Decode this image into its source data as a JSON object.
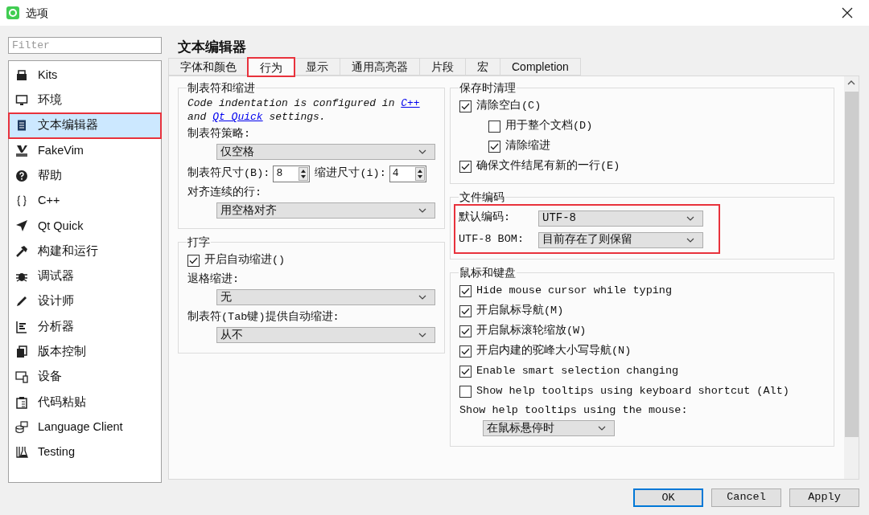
{
  "window": {
    "title": "选项"
  },
  "filter": {
    "placeholder": "Filter"
  },
  "sidebar": {
    "items": [
      {
        "label": "Kits",
        "selected": false,
        "highlighted": false
      },
      {
        "label": "环境",
        "selected": false,
        "highlighted": false
      },
      {
        "label": "文本编辑器",
        "selected": true,
        "highlighted": true
      },
      {
        "label": "FakeVim",
        "selected": false,
        "highlighted": false
      },
      {
        "label": "帮助",
        "selected": false,
        "highlighted": false
      },
      {
        "label": "C++",
        "selected": false,
        "highlighted": false
      },
      {
        "label": "Qt Quick",
        "selected": false,
        "highlighted": false
      },
      {
        "label": "构建和运行",
        "selected": false,
        "highlighted": false
      },
      {
        "label": "调试器",
        "selected": false,
        "highlighted": false
      },
      {
        "label": "设计师",
        "selected": false,
        "highlighted": false
      },
      {
        "label": "分析器",
        "selected": false,
        "highlighted": false
      },
      {
        "label": "版本控制",
        "selected": false,
        "highlighted": false
      },
      {
        "label": "设备",
        "selected": false,
        "highlighted": false
      },
      {
        "label": "代码粘贴",
        "selected": false,
        "highlighted": false
      },
      {
        "label": "Language Client",
        "selected": false,
        "highlighted": false
      },
      {
        "label": "Testing",
        "selected": false,
        "highlighted": false
      }
    ]
  },
  "page_title": "文本编辑器",
  "tabs": [
    {
      "label": "字体和颜色",
      "selected": false,
      "highlighted": false
    },
    {
      "label": "行为",
      "selected": true,
      "highlighted": true
    },
    {
      "label": "显示",
      "selected": false,
      "highlighted": false
    },
    {
      "label": "通用高亮器",
      "selected": false,
      "highlighted": false
    },
    {
      "label": "片段",
      "selected": false,
      "highlighted": false
    },
    {
      "label": "宏",
      "selected": false,
      "highlighted": false
    },
    {
      "label": "Completion",
      "selected": false,
      "highlighted": false
    }
  ],
  "left_groups": [
    {
      "title": "制表符和缩进",
      "highlighted": false,
      "rows": [
        {
          "kind": "note",
          "parts": [
            {
              "kind": "text",
              "text": "Code indentation is configured in "
            },
            {
              "kind": "link",
              "text": "C++"
            },
            {
              "kind": "text",
              "text": " and "
            },
            {
              "kind": "link",
              "text": "Qt Quick"
            },
            {
              "kind": "text",
              "text": " settings."
            }
          ]
        },
        {
          "kind": "label",
          "text": "制表符策略:"
        },
        {
          "kind": "combo",
          "value": "仅空格"
        },
        {
          "kind": "spins",
          "items": [
            {
              "label": "制表符尺寸(B):",
              "value": "8"
            },
            {
              "label": "缩进尺寸(i):",
              "value": "4"
            }
          ]
        },
        {
          "kind": "label",
          "text": "对齐连续的行:"
        },
        {
          "kind": "combo",
          "value": "用空格对齐"
        }
      ]
    },
    {
      "title": "打字",
      "highlighted": false,
      "rows": [
        {
          "kind": "checkbox",
          "text": "开启自动缩进()",
          "checked": true
        },
        {
          "kind": "label",
          "text": "退格缩进:"
        },
        {
          "kind": "combo",
          "value": "无"
        },
        {
          "kind": "label",
          "text": "制表符(Tab键)提供自动缩进:"
        },
        {
          "kind": "combo",
          "value": "从不"
        }
      ]
    }
  ],
  "right_groups": [
    {
      "title": "保存时清理",
      "highlighted": false,
      "rows": [
        {
          "kind": "checkbox",
          "text": "清除空白(C)",
          "checked": true,
          "children": [
            {
              "kind": "checkbox",
              "text": "用于整个文档(D)",
              "checked": false
            },
            {
              "kind": "checkbox",
              "text": "清除缩进",
              "checked": true
            }
          ]
        },
        {
          "kind": "checkbox",
          "text": "确保文件结尾有新的一行(E)",
          "checked": true
        }
      ]
    },
    {
      "title": "文件编码",
      "highlighted": true,
      "rows": [
        {
          "kind": "field",
          "label": "默认编码:",
          "value": "UTF-8"
        },
        {
          "kind": "field",
          "label": "UTF-8 BOM:",
          "value": "目前存在了则保留"
        }
      ]
    },
    {
      "title": "鼠标和键盘",
      "highlighted": false,
      "rows": [
        {
          "kind": "checkbox",
          "text": "Hide mouse cursor while typing",
          "checked": true
        },
        {
          "kind": "checkbox",
          "text": "开启鼠标导航(M)",
          "checked": true
        },
        {
          "kind": "checkbox",
          "text": "开启鼠标滚轮缩放(W)",
          "checked": true
        },
        {
          "kind": "checkbox",
          "text": "开启内建的驼峰大小写导航(N)",
          "checked": true
        },
        {
          "kind": "checkbox",
          "text": "Enable smart selection changing",
          "checked": true
        },
        {
          "kind": "checkbox",
          "text": "Show help tooltips using keyboard shortcut (Alt)",
          "checked": false
        },
        {
          "kind": "label",
          "text": "Show help tooltips using the mouse:"
        },
        {
          "kind": "compact_combo",
          "value": "在鼠标悬停时"
        }
      ]
    }
  ],
  "buttons": [
    {
      "label": "OK",
      "default": true
    },
    {
      "label": "Cancel",
      "default": false
    },
    {
      "label": "Apply",
      "default": false
    }
  ]
}
